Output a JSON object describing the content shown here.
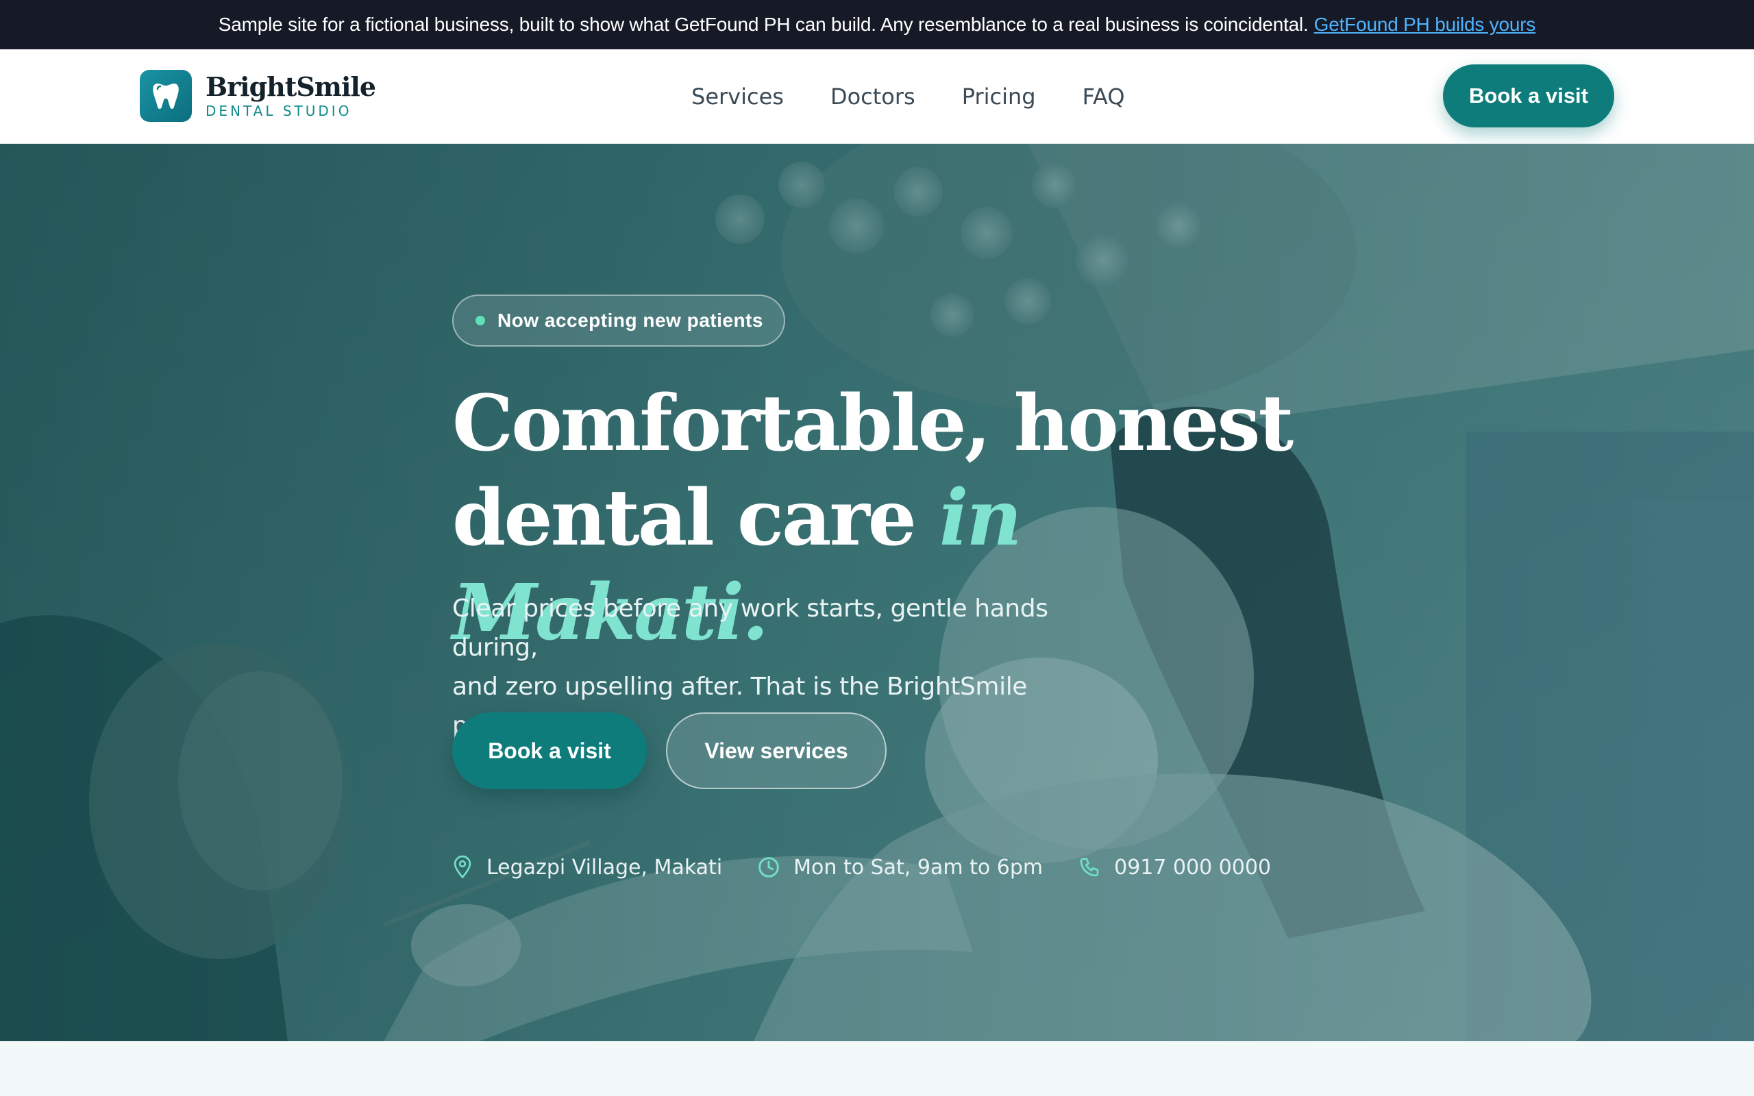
{
  "announcement": {
    "text": "Sample site for a fictional business, built to show what GetFound PH can build. Any resemblance to a real business is coincidental.",
    "link_label": "GetFound PH builds yours",
    "link_color": "#4fb3ff"
  },
  "brand": {
    "name": "BrightSmile",
    "subtitle": "DENTAL STUDIO",
    "icon": "tooth-icon",
    "primary_color": "#0f7c7c"
  },
  "nav": {
    "items": [
      {
        "label": "Services"
      },
      {
        "label": "Doctors"
      },
      {
        "label": "Pricing"
      },
      {
        "label": "FAQ"
      }
    ],
    "cta_label": "Book a visit"
  },
  "hero": {
    "badge": "Now accepting new patients",
    "badge_dot_color": "#5fe0b8",
    "headline_line1": "Comfortable, honest",
    "headline_line2": "dental care ",
    "headline_accent": "in Makati.",
    "accent_color": "#7fe3cf",
    "lede_line1": "Clear prices before any work starts, gentle hands during,",
    "lede_line2": "and zero upselling after. That is the BrightSmile promise.",
    "primary_button": "Book a visit",
    "secondary_button": "View services",
    "info": [
      {
        "icon": "map-pin-icon",
        "text": "Legazpi Village, Makati"
      },
      {
        "icon": "clock-icon",
        "text": "Mon to Sat, 9am to 6pm"
      },
      {
        "icon": "phone-icon",
        "text": "0917 000 0000"
      }
    ]
  }
}
